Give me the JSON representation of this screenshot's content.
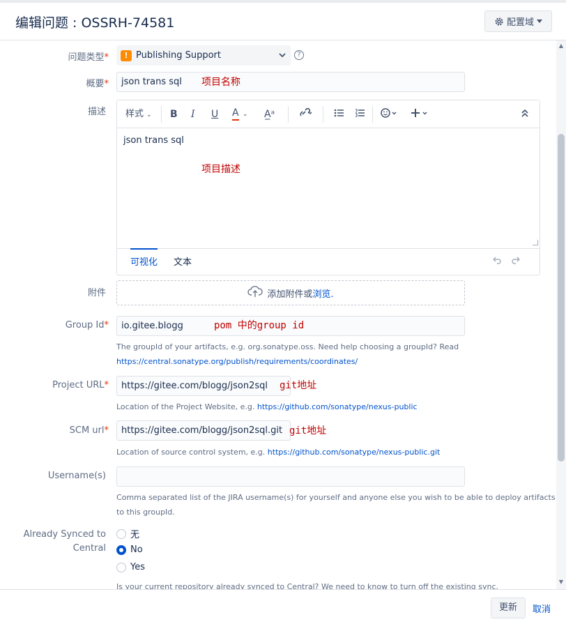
{
  "dialog": {
    "title": "编辑问题 : OSSRH-74581",
    "config_label": "配置域"
  },
  "issue_type": {
    "label": "问题类型",
    "value": "Publishing Support"
  },
  "summary": {
    "label": "概要",
    "value": "json trans sql",
    "annotation": "项目名称"
  },
  "description": {
    "label": "描述",
    "toolbar": {
      "style_label": "样式"
    },
    "content": "json trans sql",
    "annotation": "项目描述",
    "tab_visual": "可视化",
    "tab_text": "文本"
  },
  "attachment": {
    "label": "附件",
    "drop_text": "添加附件或",
    "browse_link": "浏览."
  },
  "group_id": {
    "label": "Group Id",
    "value": "io.gitee.blogg",
    "annotation": "pom 中的group id",
    "help": "The groupId of your artifacts, e.g. org.sonatype.oss. Need help choosing a groupId? Read",
    "help_link": "https://central.sonatype.org/publish/requirements/coordinates/"
  },
  "project_url": {
    "label": "Project URL",
    "value": "https://gitee.com/blogg/json2sql",
    "annotation": "git地址",
    "help": "Location of the Project Website, e.g.",
    "help_link": "https://github.com/sonatype/nexus-public"
  },
  "scm_url": {
    "label": "SCM url",
    "value": "https://gitee.com/blogg/json2sql.git",
    "annotation": "git地址",
    "help": "Location of source control system, e.g.",
    "help_link": "https://github.com/sonatype/nexus-public.git"
  },
  "usernames": {
    "label": "Username(s)",
    "value": "",
    "help_line1": "Comma separated list of the JIRA username(s) for yourself and anyone else you wish to be able to deploy artifacts",
    "help_line2": "to this groupId."
  },
  "synced": {
    "label_line1": "Already Synced to",
    "label_line2": "Central",
    "options": [
      "无",
      "No",
      "Yes"
    ],
    "selected": "No",
    "help": "Is your current repository already synced to Central? We need to know to turn off the existing sync."
  },
  "footer": {
    "update_label": "更新",
    "cancel_label": "取消"
  },
  "colors": {
    "accent": "#0052cc",
    "required": "#de350b",
    "annotation": "#c00000",
    "warning": "#ff8b00"
  }
}
